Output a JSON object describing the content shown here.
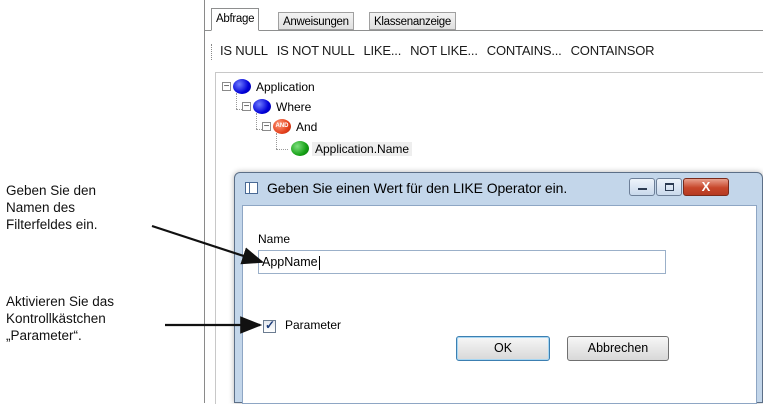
{
  "annotations": {
    "filter_field": "Geben Sie den\nNamen des\nFilterfeldes ein.",
    "parameter_checkbox": "Aktivieren Sie das\nKontrollkästchen\n„Parameter“."
  },
  "tabs": [
    {
      "label": "Abfrage",
      "active": true
    },
    {
      "label": "Anweisungen",
      "active": false
    },
    {
      "label": "Klassenanzeige",
      "active": false
    }
  ],
  "operators": [
    "IS NULL",
    "IS NOT NULL",
    "LIKE...",
    "NOT LIKE...",
    "CONTAINS...",
    "CONTAINSOR"
  ],
  "tree": {
    "application": "Application",
    "where": "Where",
    "and": "And",
    "and_badge": "AND",
    "field": "Application.Name",
    "expand_glyph": "−"
  },
  "dialog": {
    "title": "Geben Sie einen Wert für den LIKE Operator ein.",
    "field_label": "Name",
    "field_value": "AppName",
    "checkbox_label": "Parameter",
    "checkbox_checked": true,
    "ok_label": "OK",
    "cancel_label": "Abbrechen",
    "close_glyph": "X"
  },
  "icons": {
    "application_node": "blue-circle-icon",
    "where_node": "blue-circle-icon",
    "and_node": "red-and-circle-icon",
    "field_node": "green-circle-icon",
    "window_icon": "window-icon",
    "checkmark": "checkmark-icon"
  },
  "colors": {
    "blue_node": "#0000d8",
    "green_node": "#15a015",
    "red_node": "#e4401c",
    "close_button": "#c7462a",
    "dialog_frame": "#c3d6ea"
  }
}
